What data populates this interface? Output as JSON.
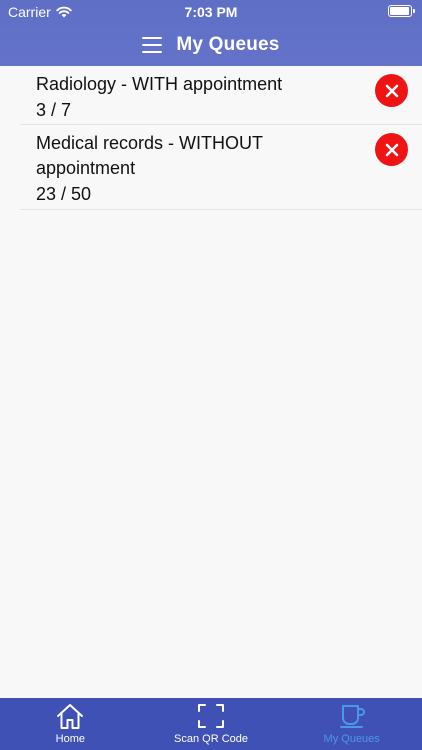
{
  "status_bar": {
    "carrier": "Carrier",
    "time": "7:03 PM"
  },
  "header": {
    "title": "My Queues"
  },
  "queues": [
    {
      "name": "Radiology - WITH appointment",
      "count": "3 / 7"
    },
    {
      "name": "Medical records - WITHOUT appointment",
      "count": "23 / 50"
    }
  ],
  "tabs": [
    {
      "label": "Home",
      "icon": "home-icon",
      "active": false
    },
    {
      "label": "Scan QR Code",
      "icon": "scan-icon",
      "active": false
    },
    {
      "label": "My Queues",
      "icon": "cup-icon",
      "active": true
    }
  ],
  "colors": {
    "header": "#6070c7",
    "tabbar": "#3f51b5",
    "active_tab": "#4e96e8",
    "remove": "#f01313"
  }
}
